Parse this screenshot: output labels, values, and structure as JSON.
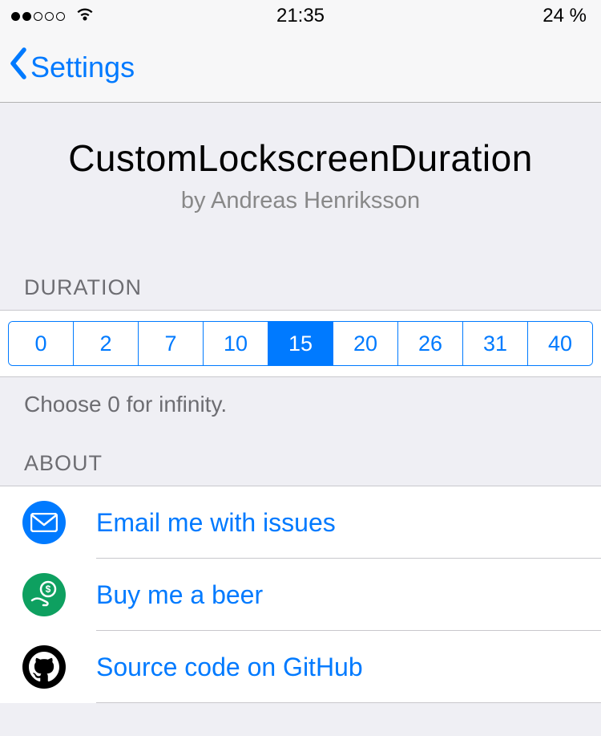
{
  "status_bar": {
    "time": "21:35",
    "battery": "24 %"
  },
  "nav": {
    "back_label": "Settings"
  },
  "header": {
    "title": "CustomLockscreenDuration",
    "subtitle": "by Andreas Henriksson"
  },
  "sections": {
    "duration_header": "DURATION",
    "duration_footer": "Choose 0 for infinity.",
    "about_header": "ABOUT"
  },
  "duration": {
    "options": [
      "0",
      "2",
      "7",
      "10",
      "15",
      "20",
      "26",
      "31",
      "40"
    ],
    "selected": "15"
  },
  "about": {
    "items": [
      {
        "label": "Email me with issues",
        "icon": "mail"
      },
      {
        "label": "Buy me a beer",
        "icon": "donate"
      },
      {
        "label": "Source code on GitHub",
        "icon": "github"
      }
    ]
  }
}
